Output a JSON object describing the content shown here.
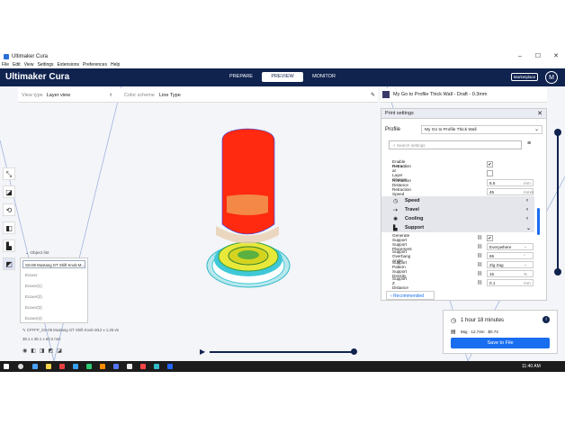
{
  "window": {
    "title": "Ultimaker Cura",
    "controls": {
      "minimize": "–",
      "maximize": "☐",
      "close": "✕"
    }
  },
  "menu": [
    "File",
    "Edit",
    "View",
    "Settings",
    "Extensions",
    "Preferences",
    "Help"
  ],
  "header": {
    "logo": "Ultimaker Cura",
    "stages": [
      "PREPARE",
      "PREVIEW",
      "MONITOR"
    ],
    "active_stage": "PREVIEW",
    "marketplace": "Marketplace",
    "account_initial": "M"
  },
  "viewbar": {
    "view_type_label": "View type",
    "view_type_value": "Layer view",
    "color_scheme_label": "Color scheme",
    "color_scheme_value": "Line Type"
  },
  "printer_bar": {
    "profile_text": "My Go to Profile Thick Wall - Draft - 0.3mm"
  },
  "print_settings": {
    "title": "Print settings",
    "profile_label": "Profile",
    "profile_value": "My Go to Profile Thick Wall",
    "search_placeholder": "Search settings",
    "rows": [
      {
        "label": "Enable Retraction",
        "type": "check",
        "checked": true
      },
      {
        "label": "Retract at Layer Change",
        "type": "check",
        "checked": false
      },
      {
        "label": "Retraction Distance",
        "value": "6.5",
        "unit": "mm"
      },
      {
        "label": "Retraction Speed",
        "value": "45",
        "unit": "mm/s"
      }
    ],
    "sections": [
      {
        "name": "Speed",
        "icon": "speed-icon",
        "glyph": "◷"
      },
      {
        "name": "Travel",
        "icon": "travel-icon",
        "glyph": "⇢"
      },
      {
        "name": "Cooling",
        "icon": "cooling-icon",
        "glyph": "✺"
      },
      {
        "name": "Support",
        "icon": "support-icon",
        "glyph": "▙"
      }
    ],
    "support_rows": [
      {
        "label": "Generate Support",
        "type": "check",
        "checked": true
      },
      {
        "label": "Support Placement",
        "value": "Everywhere",
        "type": "select"
      },
      {
        "label": "Support Overhang Angle",
        "value": "65",
        "unit": "°"
      },
      {
        "label": "Support Pattern",
        "value": "Zig Zag",
        "type": "select"
      },
      {
        "label": "Support Density",
        "value": "15",
        "unit": "%"
      },
      {
        "label": "Support Z Distance",
        "value": "0.1",
        "unit": "mm"
      }
    ],
    "recommended_button": "Recommended"
  },
  "object_list": {
    "title": "Object list",
    "selected": "SS-09 Mustang GT Shift Knob M...",
    "items": [
      "Ecoxer",
      "Ecoxer(1)",
      "Ecoxer(2)",
      "Ecoxer(3)",
      "Ecoxer(4)"
    ],
    "object_name": "CFFFP_SS-09 Mustang GT Shift Knob M12 x 1.25 v5",
    "dimensions": "38.1 x 38.1 x 60.2 mm"
  },
  "print_job": {
    "time": "1 hour 18 minutes",
    "details": "56g · 12.74m · $0.73",
    "save_button": "Save to File"
  },
  "taskbar": {
    "time": "11:40 AM"
  },
  "colors": {
    "header_bg": "#10234f",
    "accent": "#196ef0",
    "model_red": "#ff2a10",
    "model_yellow": "#e8e83a",
    "model_cyan": "#40d0d8",
    "model_green": "#30c040"
  }
}
